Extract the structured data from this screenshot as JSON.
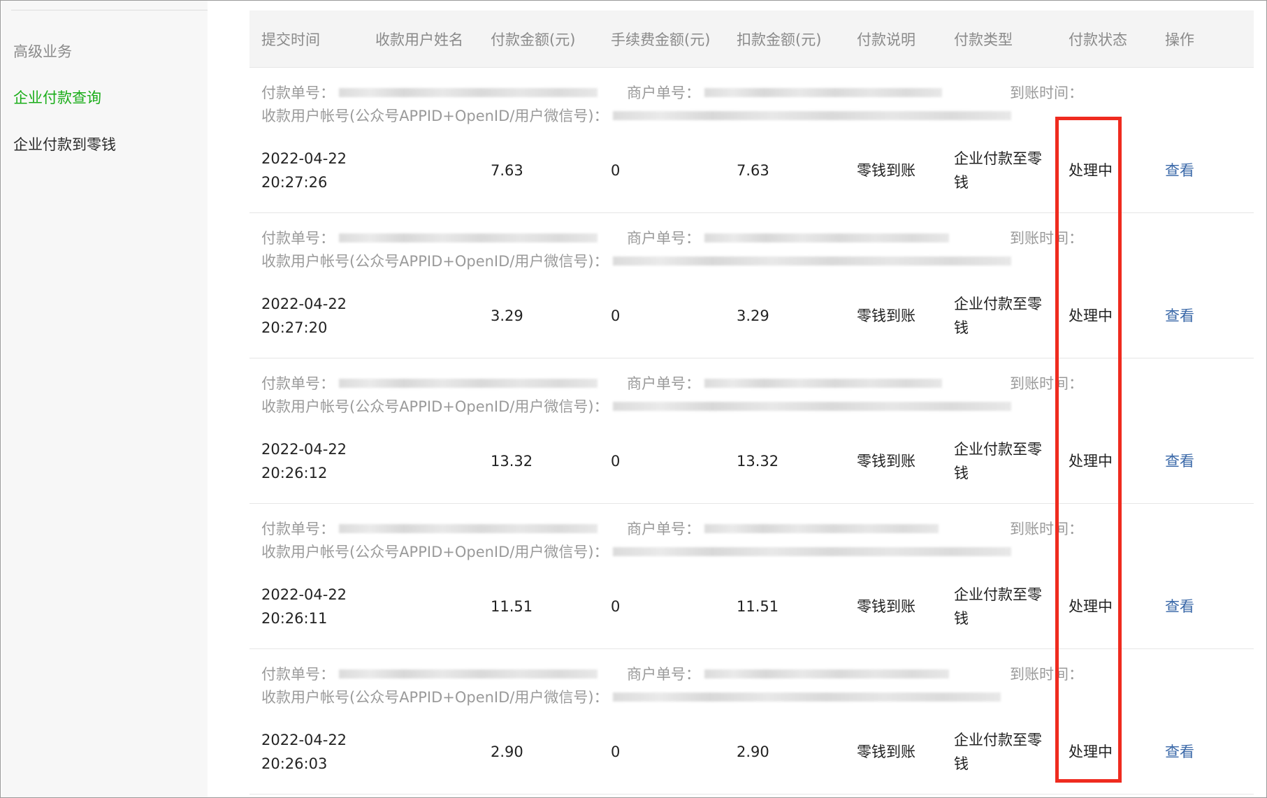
{
  "sidebar": {
    "section_title": "高级业务",
    "items": [
      {
        "label": "企业付款查询",
        "active": true
      },
      {
        "label": "企业付款到零钱",
        "active": false
      }
    ]
  },
  "table": {
    "headers": [
      "提交时间",
      "收款用户姓名",
      "付款金额(元)",
      "手续费金额(元)",
      "扣款金额(元)",
      "付款说明",
      "付款类型",
      "付款状态",
      "操作"
    ],
    "meta_labels": {
      "payment_no": "付款单号：",
      "merchant_no": "商户单号：",
      "arrival_time": "到账时间：",
      "account": "收款用户帐号(公众号APPID+OpenID/用户微信号)："
    },
    "rows": [
      {
        "submit_time": "2022-04-22 20:27:26",
        "payee_name": "",
        "amount": "7.63",
        "fee": "0",
        "deduct": "7.63",
        "note": "零钱到账",
        "type": "企业付款至零钱",
        "status": "处理中",
        "action": "查看"
      },
      {
        "submit_time": "2022-04-22 20:27:20",
        "payee_name": "",
        "amount": "3.29",
        "fee": "0",
        "deduct": "3.29",
        "note": "零钱到账",
        "type": "企业付款至零钱",
        "status": "处理中",
        "action": "查看"
      },
      {
        "submit_time": "2022-04-22 20:26:12",
        "payee_name": "",
        "amount": "13.32",
        "fee": "0",
        "deduct": "13.32",
        "note": "零钱到账",
        "type": "企业付款至零钱",
        "status": "处理中",
        "action": "查看"
      },
      {
        "submit_time": "2022-04-22 20:26:11",
        "payee_name": "",
        "amount": "11.51",
        "fee": "0",
        "deduct": "11.51",
        "note": "零钱到账",
        "type": "企业付款至零钱",
        "status": "处理中",
        "action": "查看"
      },
      {
        "submit_time": "2022-04-22 20:26:03",
        "payee_name": "",
        "amount": "2.90",
        "fee": "0",
        "deduct": "2.90",
        "note": "零钱到账",
        "type": "企业付款至零钱",
        "status": "处理中",
        "action": "查看"
      }
    ]
  },
  "colors": {
    "active_nav": "#1aad19",
    "link": "#3a68a8",
    "highlight_border": "#ef2b1f"
  }
}
